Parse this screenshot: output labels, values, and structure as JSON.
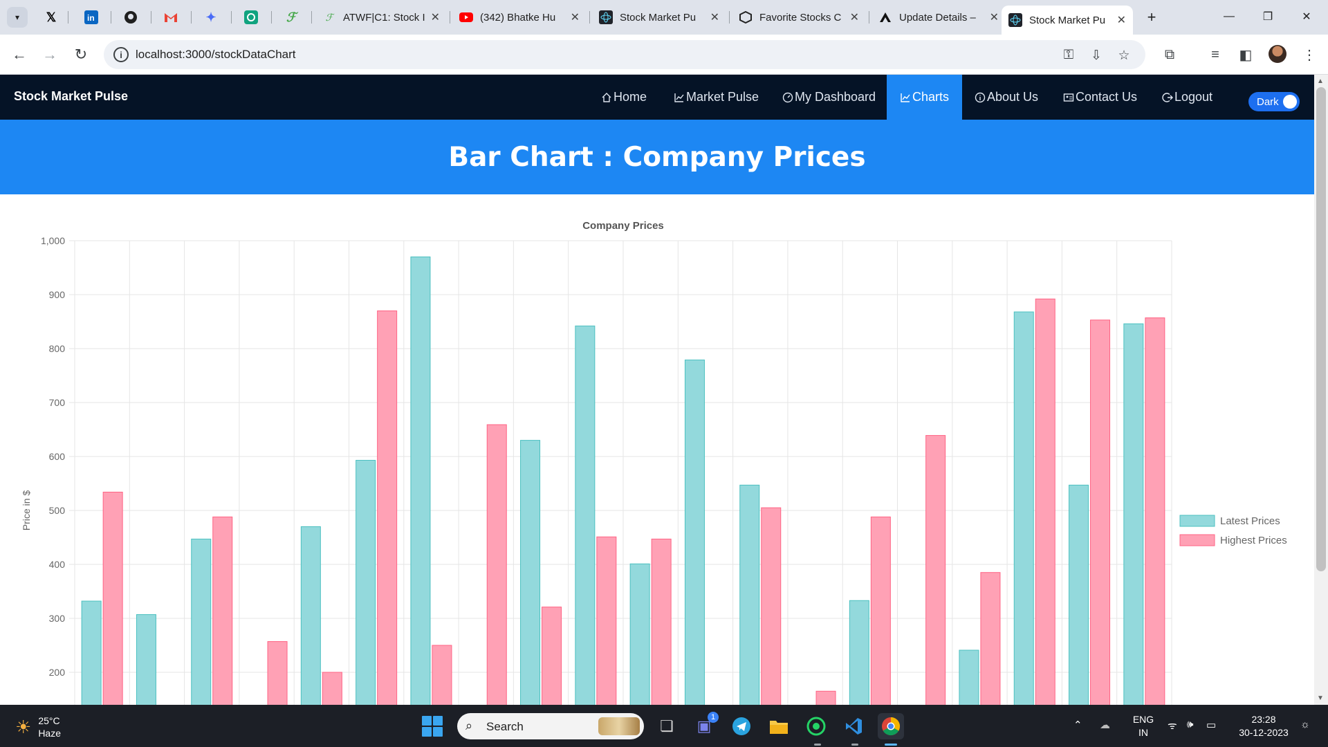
{
  "browser": {
    "tabs": [
      {
        "title": "",
        "icon": "x-icon",
        "pinned": true
      },
      {
        "title": "",
        "icon": "linkedin-icon",
        "pinned": true
      },
      {
        "title": "",
        "icon": "github-icon",
        "pinned": true
      },
      {
        "title": "",
        "icon": "gmail-icon",
        "pinned": true
      },
      {
        "title": "",
        "icon": "sparkle-icon",
        "pinned": true
      },
      {
        "title": "",
        "icon": "chatgpt-icon",
        "pinned": true
      },
      {
        "title": "",
        "icon": "leaf-icon",
        "pinned": true
      },
      {
        "title": "ATWF|C1: Stock I",
        "icon": "leaf-icon"
      },
      {
        "title": "(342) Bhatke Hu",
        "icon": "youtube-icon"
      },
      {
        "title": "Stock Market Pu",
        "icon": "react-icon"
      },
      {
        "title": "Favorite Stocks C",
        "icon": "cube-icon"
      },
      {
        "title": "Update Details –",
        "icon": "vercel-icon"
      },
      {
        "title": "Stock Market Pu",
        "icon": "react-icon",
        "active": true
      }
    ],
    "url": "localhost:3000/stockDataChart"
  },
  "app": {
    "brand": "Stock Market Pulse",
    "nav": [
      {
        "label": "Home",
        "icon": "home-icon"
      },
      {
        "label": "Market Pulse",
        "icon": "chart-line-icon"
      },
      {
        "label": "My Dashboard",
        "icon": "dashboard-icon"
      },
      {
        "label": "Charts",
        "icon": "chart-line-icon",
        "active": true
      },
      {
        "label": "About Us",
        "icon": "info-icon"
      },
      {
        "label": "Contact Us",
        "icon": "contact-card-icon"
      },
      {
        "label": "Logout",
        "icon": "logout-icon"
      }
    ],
    "theme_toggle": {
      "label": "Dark",
      "on": true
    },
    "page_heading": "Bar Chart : Company Prices"
  },
  "chart_data": {
    "type": "bar",
    "title": "Company Prices",
    "ylabel": "Price in $",
    "xlabel": "",
    "ylim": [
      200,
      1000
    ],
    "yticks": [
      1000,
      900,
      800,
      700,
      600,
      500,
      400,
      300,
      200
    ],
    "ytick_labels": [
      "1,000",
      "900",
      "800",
      "700",
      "600",
      "500",
      "400",
      "300",
      "200"
    ],
    "grid": true,
    "legend": "right",
    "categories_count": 20,
    "series": [
      {
        "name": "Latest Prices",
        "fill": "#93d9dc",
        "stroke": "#4bc0c0",
        "values": [
          332,
          307,
          447,
          0,
          470,
          593,
          970,
          0,
          630,
          842,
          401,
          779,
          547,
          0,
          333,
          0,
          241,
          868,
          547,
          846
        ]
      },
      {
        "name": "Highest Prices",
        "fill": "#ffa1b5",
        "stroke": "#ff6384",
        "values": [
          534,
          0,
          488,
          257,
          200,
          870,
          250,
          659,
          321,
          451,
          447,
          0,
          505,
          165,
          488,
          639,
          385,
          892,
          853,
          857
        ]
      }
    ]
  },
  "taskbar": {
    "weather_temp": "25°C",
    "weather_desc": "Haze",
    "search_label": "Search",
    "chat_badge": "1",
    "lang_top": "ENG",
    "lang_bottom": "IN",
    "time": "23:28",
    "date": "30-12-2023"
  }
}
